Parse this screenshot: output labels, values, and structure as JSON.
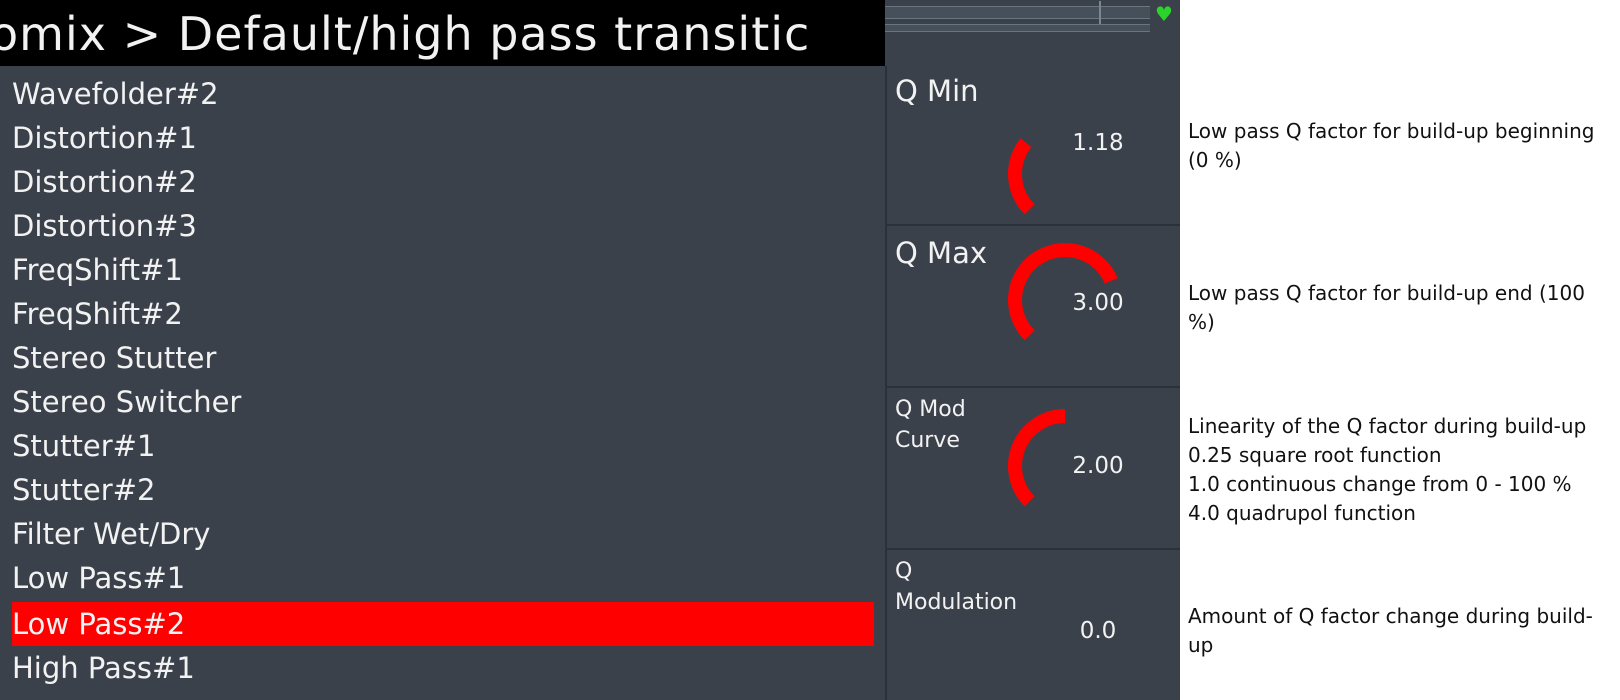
{
  "title": "omix > Default/high pass transitic",
  "colors": {
    "accent": "#ff0000",
    "panel": "#3b414b",
    "heart": "#2bd42b"
  },
  "list": {
    "items": [
      "Wavefolder#2",
      "Distortion#1",
      "Distortion#2",
      "Distortion#3",
      "FreqShift#1",
      "FreqShift#2",
      "Stereo Stutter",
      "Stereo Switcher",
      "Stutter#1",
      "Stutter#2",
      "Filter Wet/Dry",
      "Low Pass#1",
      "Low Pass#2",
      "High Pass#1"
    ],
    "selected": "Low Pass#2"
  },
  "params": [
    {
      "label": "Q Min",
      "value": "1.18",
      "fraction": 0.31,
      "description": "Low pass Q factor for build-up beginning (0 %)"
    },
    {
      "label": "Q Max",
      "value": "3.00",
      "fraction": 0.75,
      "description": "Low pass Q factor for build-up end (100 %)"
    },
    {
      "label": "Q Mod\nCurve",
      "value": "2.00",
      "fraction": 0.5,
      "description": "Linearity of the Q factor during build-up\n0.25 square root function\n1.0 continuous change from 0 - 100 %\n4.0 quadrupol function"
    },
    {
      "label": "Q\nModulation",
      "value": "0.0",
      "fraction": 0.0,
      "description": "Amount of Q factor change during build-up"
    }
  ]
}
